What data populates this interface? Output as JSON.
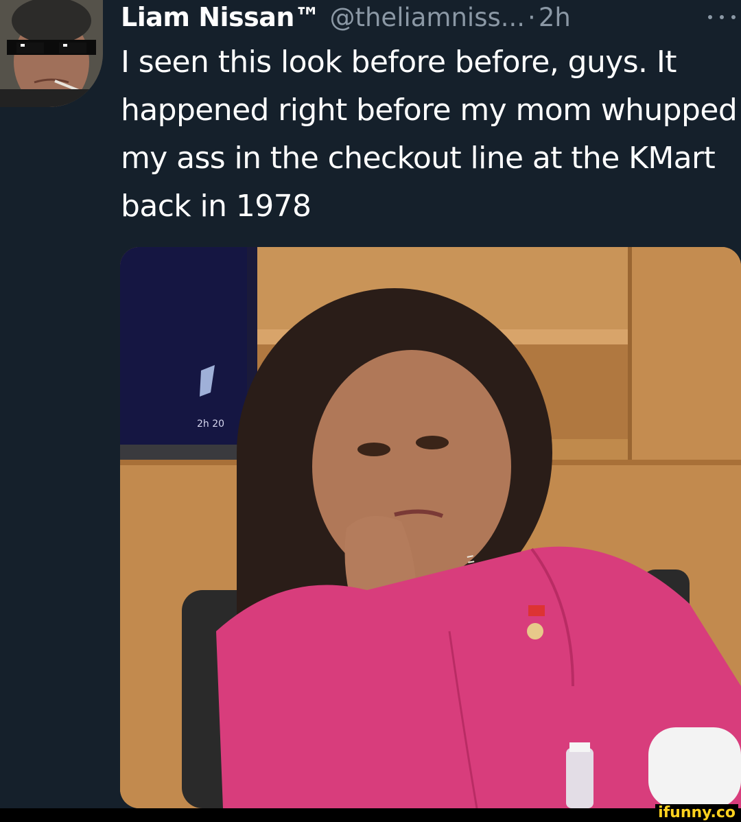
{
  "tweet": {
    "display_name": "Liam Nissan™",
    "handle": "@theliamniss...",
    "separator": "·",
    "time": "2h",
    "text": "I seen this look before before, guys. It happened right before my mom whupped my ass in the checkout line at the KMart back in 1978",
    "more_icon": "more-horizontal-icon"
  },
  "media": {
    "screen_label": "2h 20"
  },
  "watermark": {
    "text": "ifunny.co"
  },
  "colors": {
    "background": "#15202b",
    "text_primary": "#ffffff",
    "text_secondary": "#8b98a5",
    "watermark": "#ffd21f"
  }
}
